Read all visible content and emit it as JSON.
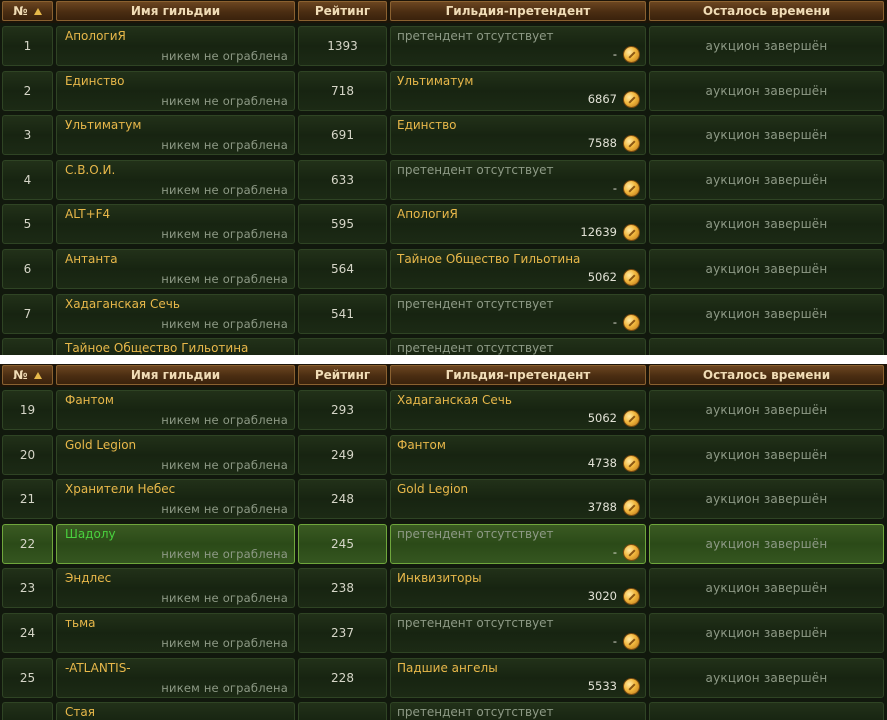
{
  "header": {
    "rank": "№",
    "guild_name": "Имя гильдии",
    "rating": "Рейтинг",
    "challenger": "Гильдия-претендент",
    "time_left": "Осталось времени"
  },
  "icons": {
    "sort": "sort-up-arrow-icon",
    "currency": "gold-coin-icon"
  },
  "colors": {
    "guild_name": "#e8b84a",
    "highlight_guild_name": "#49d13e",
    "muted_text": "#8e9a86",
    "header_text": "#f0dcb6"
  },
  "top_table": {
    "rows": [
      {
        "rank": "1",
        "name": "АпологиЯ",
        "status": "никем не ограблена",
        "rating": "1393",
        "challenger": "претендент отсутствует",
        "bid": "-",
        "time": "аукцион завершён"
      },
      {
        "rank": "2",
        "name": "Единство",
        "status": "никем не ограблена",
        "rating": "718",
        "challenger": "Ультиматум",
        "bid": "6867",
        "time": "аукцион завершён"
      },
      {
        "rank": "3",
        "name": "Ультиматум",
        "status": "никем не ограблена",
        "rating": "691",
        "challenger": "Единство",
        "bid": "7588",
        "time": "аукцион завершён"
      },
      {
        "rank": "4",
        "name": "С.В.О.И.",
        "status": "никем не ограблена",
        "rating": "633",
        "challenger": "претендент отсутствует",
        "bid": "-",
        "time": "аукцион завершён"
      },
      {
        "rank": "5",
        "name": "ALT+F4",
        "status": "никем не ограблена",
        "rating": "595",
        "challenger": "АпологиЯ",
        "bid": "12639",
        "time": "аукцион завершён"
      },
      {
        "rank": "6",
        "name": "Антанта",
        "status": "никем не ограблена",
        "rating": "564",
        "challenger": "Тайное Общество Гильотина",
        "bid": "5062",
        "time": "аукцион завершён"
      },
      {
        "rank": "7",
        "name": "Хадаганская Сечь",
        "status": "никем не ограблена",
        "rating": "541",
        "challenger": "претендент отсутствует",
        "bid": "-",
        "time": "аукцион завершён"
      }
    ],
    "partial_row": {
      "name": "Тайное Общество Гильотина",
      "challenger": "претендент отсутствует"
    }
  },
  "bottom_table": {
    "rows": [
      {
        "rank": "19",
        "name": "Фантом",
        "status": "никем не ограблена",
        "rating": "293",
        "challenger": "Хадаганская Сечь",
        "bid": "5062",
        "time": "аукцион завершён"
      },
      {
        "rank": "20",
        "name": "Gold Legion",
        "status": "никем не ограблена",
        "rating": "249",
        "challenger": "Фантом",
        "bid": "4738",
        "time": "аукцион завершён"
      },
      {
        "rank": "21",
        "name": "Хранители Небес",
        "status": "никем не ограблена",
        "rating": "248",
        "challenger": "Gold Legion",
        "bid": "3788",
        "time": "аукцион завершён"
      },
      {
        "rank": "22",
        "name": "Шадолу",
        "status": "никем не ограблена",
        "rating": "245",
        "challenger": "претендент отсутствует",
        "bid": "-",
        "time": "аукцион завершён",
        "highlight": true
      },
      {
        "rank": "23",
        "name": "Эндлес",
        "status": "никем не ограблена",
        "rating": "238",
        "challenger": "Инквизиторы",
        "bid": "3020",
        "time": "аукцион завершён"
      },
      {
        "rank": "24",
        "name": "тьма",
        "status": "никем не ограблена",
        "rating": "237",
        "challenger": "претендент отсутствует",
        "bid": "-",
        "time": "аукцион завершён"
      },
      {
        "rank": "25",
        "name": "-ATLANTIS-",
        "status": "никем не ограблена",
        "rating": "228",
        "challenger": "Падшие ангелы",
        "bid": "5533",
        "time": "аукцион завершён"
      }
    ],
    "partial_row": {
      "name": "Стая",
      "challenger": "претендент отсутствует"
    }
  }
}
